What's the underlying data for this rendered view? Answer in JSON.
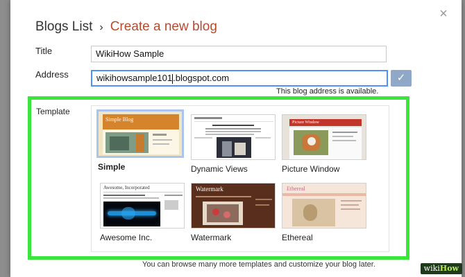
{
  "modal": {
    "breadcrumb_root": "Blogs List",
    "breadcrumb_separator": "›",
    "breadcrumb_current": "Create a new blog",
    "close_icon": "×"
  },
  "form": {
    "title_label": "Title",
    "title_value": "WikiHow Sample",
    "address_label": "Address",
    "address_value_before_caret": "wikihowsample101",
    "address_value_after_caret": ".blogspot.com",
    "check_icon": "✓",
    "availability_text": "This blog address is available."
  },
  "templates": {
    "label": "Template",
    "selected": "Simple",
    "items": [
      {
        "name": "Simple",
        "thumb_title": "Simple Blog"
      },
      {
        "name": "Dynamic Views"
      },
      {
        "name": "Picture Window",
        "thumb_title": "Picture Window"
      },
      {
        "name": "Awesome Inc.",
        "thumb_title": "Awesome, Incorporated"
      },
      {
        "name": "Watermark",
        "thumb_title": "Watermark"
      },
      {
        "name": "Ethereal",
        "thumb_title": "Ethereal"
      }
    ]
  },
  "footer_text": "You can browse many more templates and customize your blog later.",
  "watermark": {
    "part1": "wiki",
    "part2": "How"
  },
  "colors": {
    "highlight_green": "#39e639",
    "breadcrumb_accent": "#b74a2e",
    "focus_blue": "#4d90fe"
  }
}
